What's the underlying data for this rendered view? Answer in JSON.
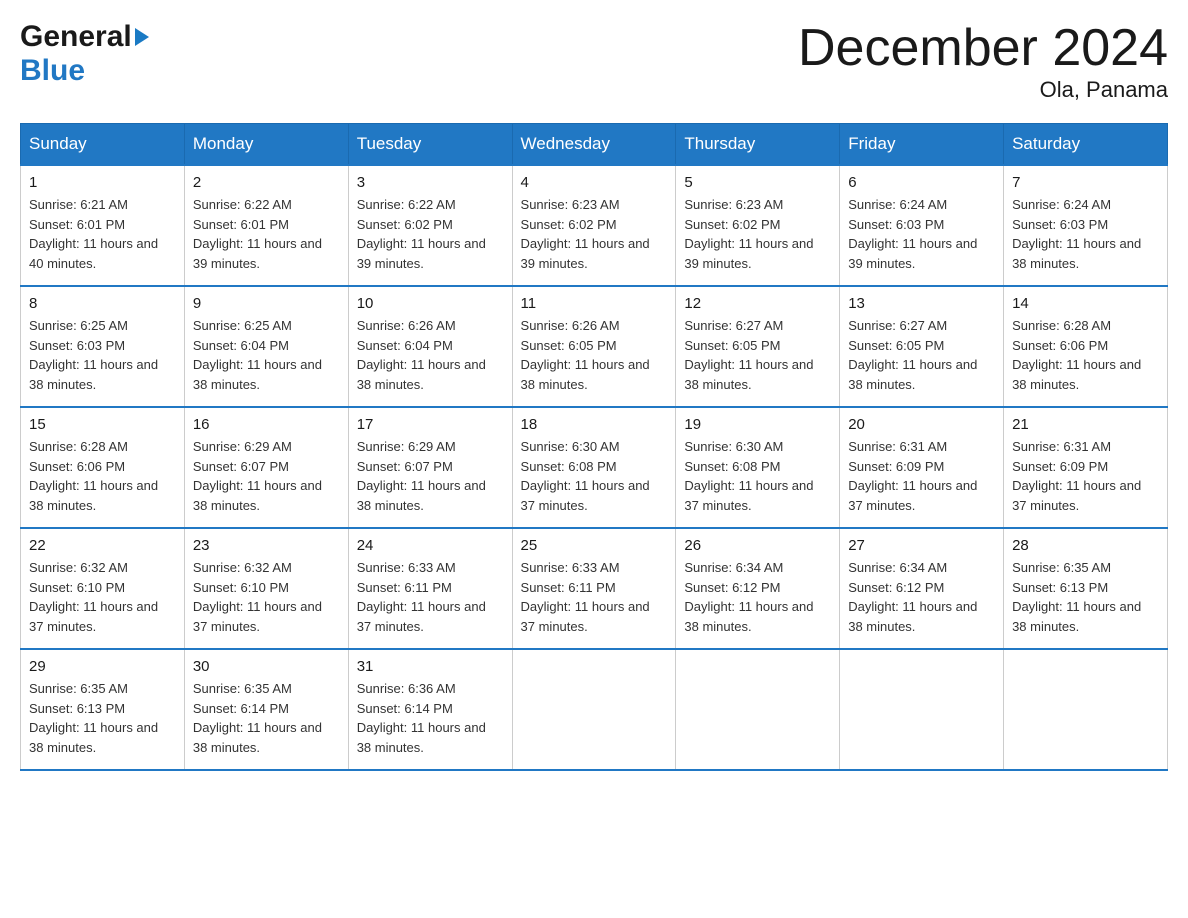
{
  "header": {
    "logo_general": "General",
    "logo_blue": "Blue",
    "title": "December 2024",
    "location": "Ola, Panama"
  },
  "calendar": {
    "days_of_week": [
      "Sunday",
      "Monday",
      "Tuesday",
      "Wednesday",
      "Thursday",
      "Friday",
      "Saturday"
    ],
    "weeks": [
      [
        {
          "num": "1",
          "sunrise": "6:21 AM",
          "sunset": "6:01 PM",
          "daylight": "11 hours and 40 minutes."
        },
        {
          "num": "2",
          "sunrise": "6:22 AM",
          "sunset": "6:01 PM",
          "daylight": "11 hours and 39 minutes."
        },
        {
          "num": "3",
          "sunrise": "6:22 AM",
          "sunset": "6:02 PM",
          "daylight": "11 hours and 39 minutes."
        },
        {
          "num": "4",
          "sunrise": "6:23 AM",
          "sunset": "6:02 PM",
          "daylight": "11 hours and 39 minutes."
        },
        {
          "num": "5",
          "sunrise": "6:23 AM",
          "sunset": "6:02 PM",
          "daylight": "11 hours and 39 minutes."
        },
        {
          "num": "6",
          "sunrise": "6:24 AM",
          "sunset": "6:03 PM",
          "daylight": "11 hours and 39 minutes."
        },
        {
          "num": "7",
          "sunrise": "6:24 AM",
          "sunset": "6:03 PM",
          "daylight": "11 hours and 38 minutes."
        }
      ],
      [
        {
          "num": "8",
          "sunrise": "6:25 AM",
          "sunset": "6:03 PM",
          "daylight": "11 hours and 38 minutes."
        },
        {
          "num": "9",
          "sunrise": "6:25 AM",
          "sunset": "6:04 PM",
          "daylight": "11 hours and 38 minutes."
        },
        {
          "num": "10",
          "sunrise": "6:26 AM",
          "sunset": "6:04 PM",
          "daylight": "11 hours and 38 minutes."
        },
        {
          "num": "11",
          "sunrise": "6:26 AM",
          "sunset": "6:05 PM",
          "daylight": "11 hours and 38 minutes."
        },
        {
          "num": "12",
          "sunrise": "6:27 AM",
          "sunset": "6:05 PM",
          "daylight": "11 hours and 38 minutes."
        },
        {
          "num": "13",
          "sunrise": "6:27 AM",
          "sunset": "6:05 PM",
          "daylight": "11 hours and 38 minutes."
        },
        {
          "num": "14",
          "sunrise": "6:28 AM",
          "sunset": "6:06 PM",
          "daylight": "11 hours and 38 minutes."
        }
      ],
      [
        {
          "num": "15",
          "sunrise": "6:28 AM",
          "sunset": "6:06 PM",
          "daylight": "11 hours and 38 minutes."
        },
        {
          "num": "16",
          "sunrise": "6:29 AM",
          "sunset": "6:07 PM",
          "daylight": "11 hours and 38 minutes."
        },
        {
          "num": "17",
          "sunrise": "6:29 AM",
          "sunset": "6:07 PM",
          "daylight": "11 hours and 38 minutes."
        },
        {
          "num": "18",
          "sunrise": "6:30 AM",
          "sunset": "6:08 PM",
          "daylight": "11 hours and 37 minutes."
        },
        {
          "num": "19",
          "sunrise": "6:30 AM",
          "sunset": "6:08 PM",
          "daylight": "11 hours and 37 minutes."
        },
        {
          "num": "20",
          "sunrise": "6:31 AM",
          "sunset": "6:09 PM",
          "daylight": "11 hours and 37 minutes."
        },
        {
          "num": "21",
          "sunrise": "6:31 AM",
          "sunset": "6:09 PM",
          "daylight": "11 hours and 37 minutes."
        }
      ],
      [
        {
          "num": "22",
          "sunrise": "6:32 AM",
          "sunset": "6:10 PM",
          "daylight": "11 hours and 37 minutes."
        },
        {
          "num": "23",
          "sunrise": "6:32 AM",
          "sunset": "6:10 PM",
          "daylight": "11 hours and 37 minutes."
        },
        {
          "num": "24",
          "sunrise": "6:33 AM",
          "sunset": "6:11 PM",
          "daylight": "11 hours and 37 minutes."
        },
        {
          "num": "25",
          "sunrise": "6:33 AM",
          "sunset": "6:11 PM",
          "daylight": "11 hours and 37 minutes."
        },
        {
          "num": "26",
          "sunrise": "6:34 AM",
          "sunset": "6:12 PM",
          "daylight": "11 hours and 38 minutes."
        },
        {
          "num": "27",
          "sunrise": "6:34 AM",
          "sunset": "6:12 PM",
          "daylight": "11 hours and 38 minutes."
        },
        {
          "num": "28",
          "sunrise": "6:35 AM",
          "sunset": "6:13 PM",
          "daylight": "11 hours and 38 minutes."
        }
      ],
      [
        {
          "num": "29",
          "sunrise": "6:35 AM",
          "sunset": "6:13 PM",
          "daylight": "11 hours and 38 minutes."
        },
        {
          "num": "30",
          "sunrise": "6:35 AM",
          "sunset": "6:14 PM",
          "daylight": "11 hours and 38 minutes."
        },
        {
          "num": "31",
          "sunrise": "6:36 AM",
          "sunset": "6:14 PM",
          "daylight": "11 hours and 38 minutes."
        },
        null,
        null,
        null,
        null
      ]
    ]
  }
}
